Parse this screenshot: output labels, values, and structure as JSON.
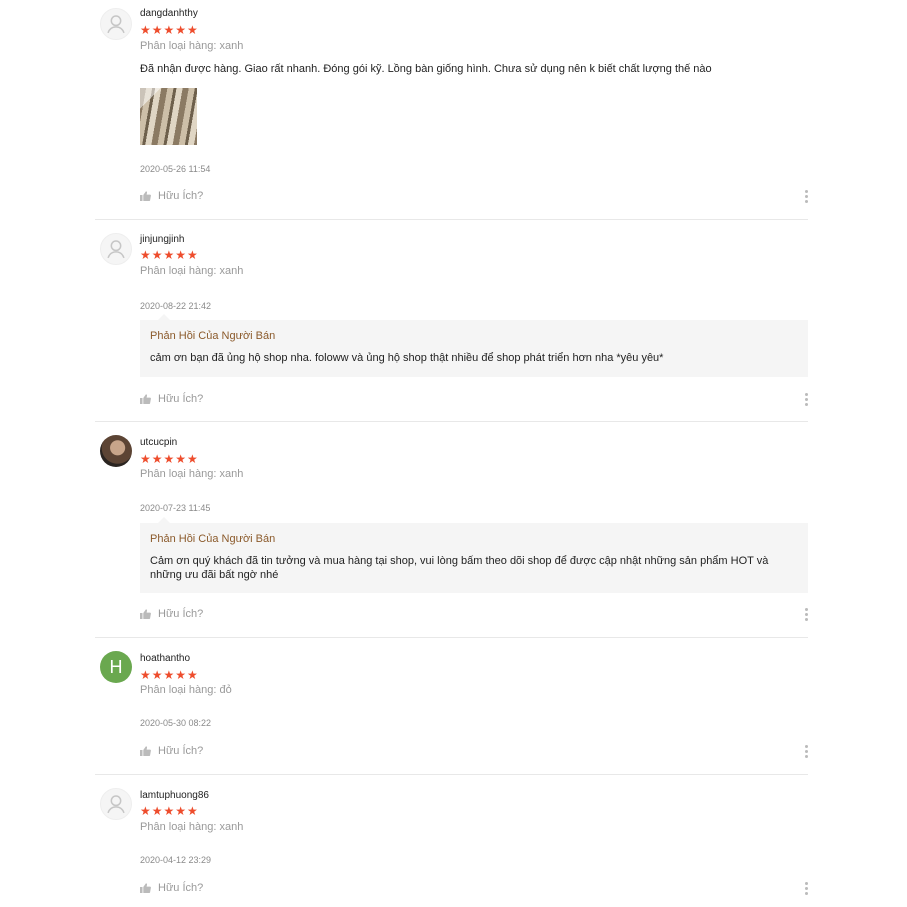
{
  "reviews": [
    {
      "username": "dangdanhthy",
      "stars": "★★★★★",
      "variant": "Phân loại hàng: xanh",
      "comment": "Đã nhận được hàng. Giao rất nhanh. Đóng gói kỹ. Lồng bàn giống hình. Chưa sử dụng nên k biết chất lượng thế nào",
      "date": "2020-05-26 11:54",
      "helpful": "Hữu Ích?"
    },
    {
      "username": "jinjungjinh",
      "stars": "★★★★★",
      "variant": "Phân loại hàng: xanh",
      "date": "2020-08-22 21:42",
      "reply_title": "Phản Hồi Của Người Bán",
      "reply_text": "cảm ơn bạn đã ủng hộ shop nha. foloww và ủng hộ shop thật nhiều để shop phát triển hơn nha *yêu yêu*",
      "helpful": "Hữu Ích?"
    },
    {
      "username": "utcucpin",
      "stars": "★★★★★",
      "variant": "Phân loại hàng: xanh",
      "date": "2020-07-23 11:45",
      "reply_title": "Phản Hồi Của Người Bán",
      "reply_text": "Cảm ơn quý khách đã tin tưởng và mua hàng tại shop, vui lòng bấm theo dõi shop để được cập nhật những sản phẩm HOT và những ưu đãi bất ngờ nhé",
      "helpful": "Hữu Ích?"
    },
    {
      "username": "hoathantho",
      "avatar_letter": "H",
      "stars": "★★★★★",
      "variant": "Phân loại hàng: đỏ",
      "date": "2020-05-30 08:22",
      "helpful": "Hữu Ích?"
    },
    {
      "username": "lamtuphuong86",
      "stars": "★★★★★",
      "variant": "Phân loại hàng: xanh",
      "date": "2020-04-12 23:29",
      "helpful": "Hữu Ích?"
    }
  ],
  "colors": {
    "star": "#ee4d2d",
    "reply_title": "#8b5a2b",
    "avatar_letter_bg": "#6aa84f"
  }
}
